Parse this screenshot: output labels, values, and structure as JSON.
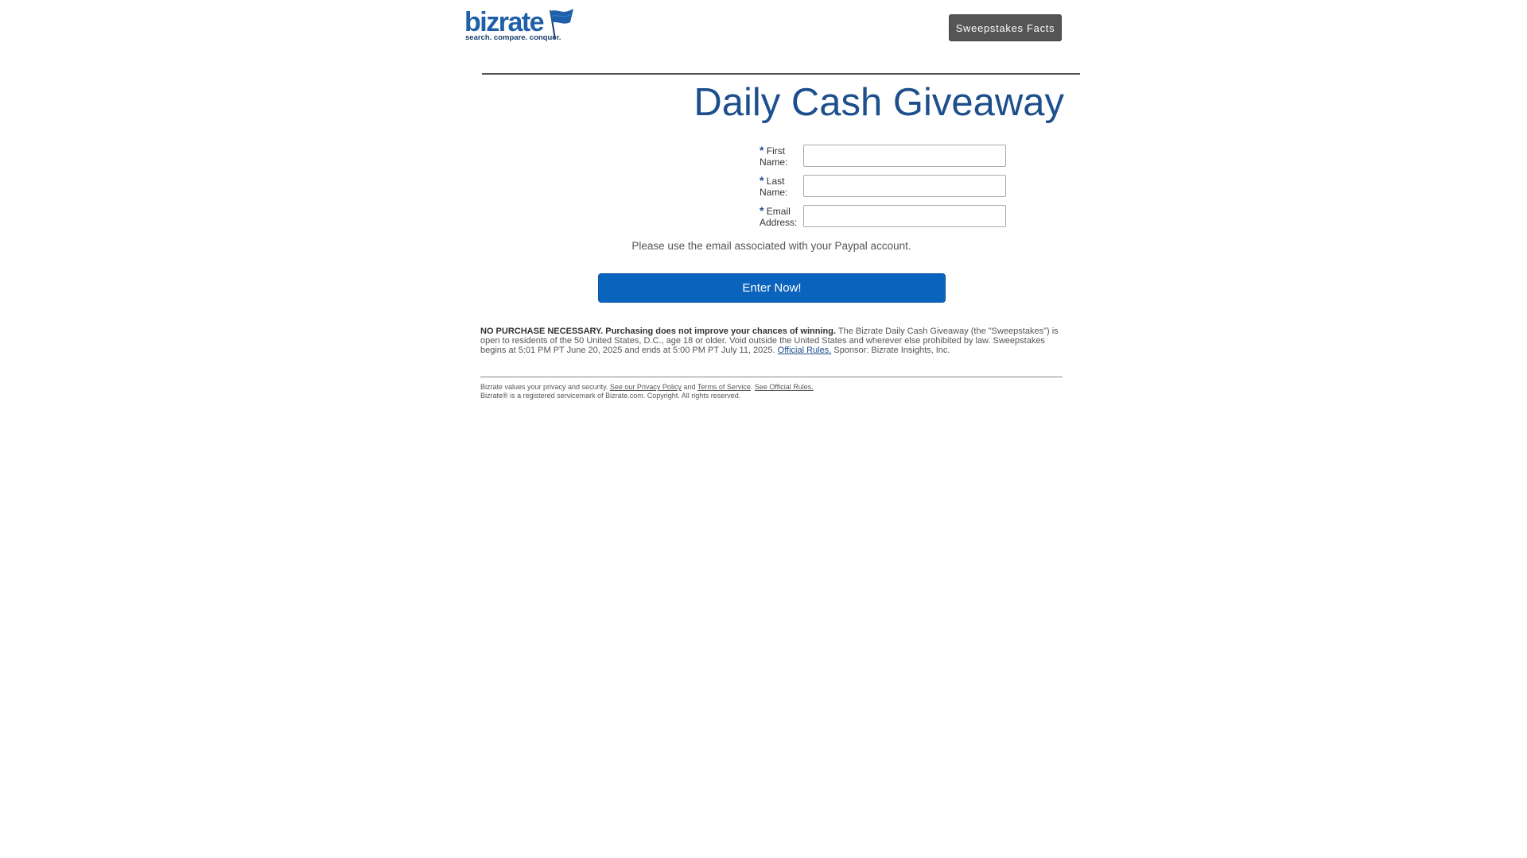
{
  "brand": {
    "name": "bizrate",
    "tagline": "search. compare. conquer.",
    "colors": {
      "primary": "#1f5fa8",
      "dark": "#163f6e"
    },
    "icon": "flag-icon"
  },
  "header": {
    "sweepstakes_facts_label": "Sweepstakes Facts"
  },
  "title": "Daily Cash Giveaway",
  "form": {
    "required_marker": "*",
    "first_name": {
      "label_line1": "First",
      "label_line2": "Name:",
      "value": ""
    },
    "last_name": {
      "label_line1": "Last",
      "label_line2": "Name:",
      "value": ""
    },
    "email": {
      "label_line1": "Email",
      "label_line2": "Address:",
      "value": ""
    },
    "note": "Please use the email associated with your Paypal account.",
    "submit_label": "Enter Now!",
    "submit_color": "#0a63bd"
  },
  "legal": {
    "bold_text": "NO PURCHASE NECESSARY. Purchasing does not improve your chances of winning.",
    "body_text": " The Bizrate Daily Cash Giveaway (the \"Sweepstakes\") is open to residents of the 50 United States, D.C., age 18 or older. Void outside the United States and wherever else prohibited by law. Sweepstakes begins at 5:01 PM PT June 20, 2025 and ends at 5:00 PM PT July 11, 2025. ",
    "rules_link": "Official Rules.",
    "sponsor_text": " Sponsor: Bizrate Insights, Inc."
  },
  "footer": {
    "privacy_text": "Bizrate values your privacy and security. ",
    "privacy_link": "See our Privacy Policy",
    "and_text": " and ",
    "terms_link": "Terms of Service",
    "sep_text": ". ",
    "rules_link": "See Official Rules.",
    "copyright": "Bizrate® is a registered servicemark of Bizrate.com. Copyright. All rights reserved."
  }
}
